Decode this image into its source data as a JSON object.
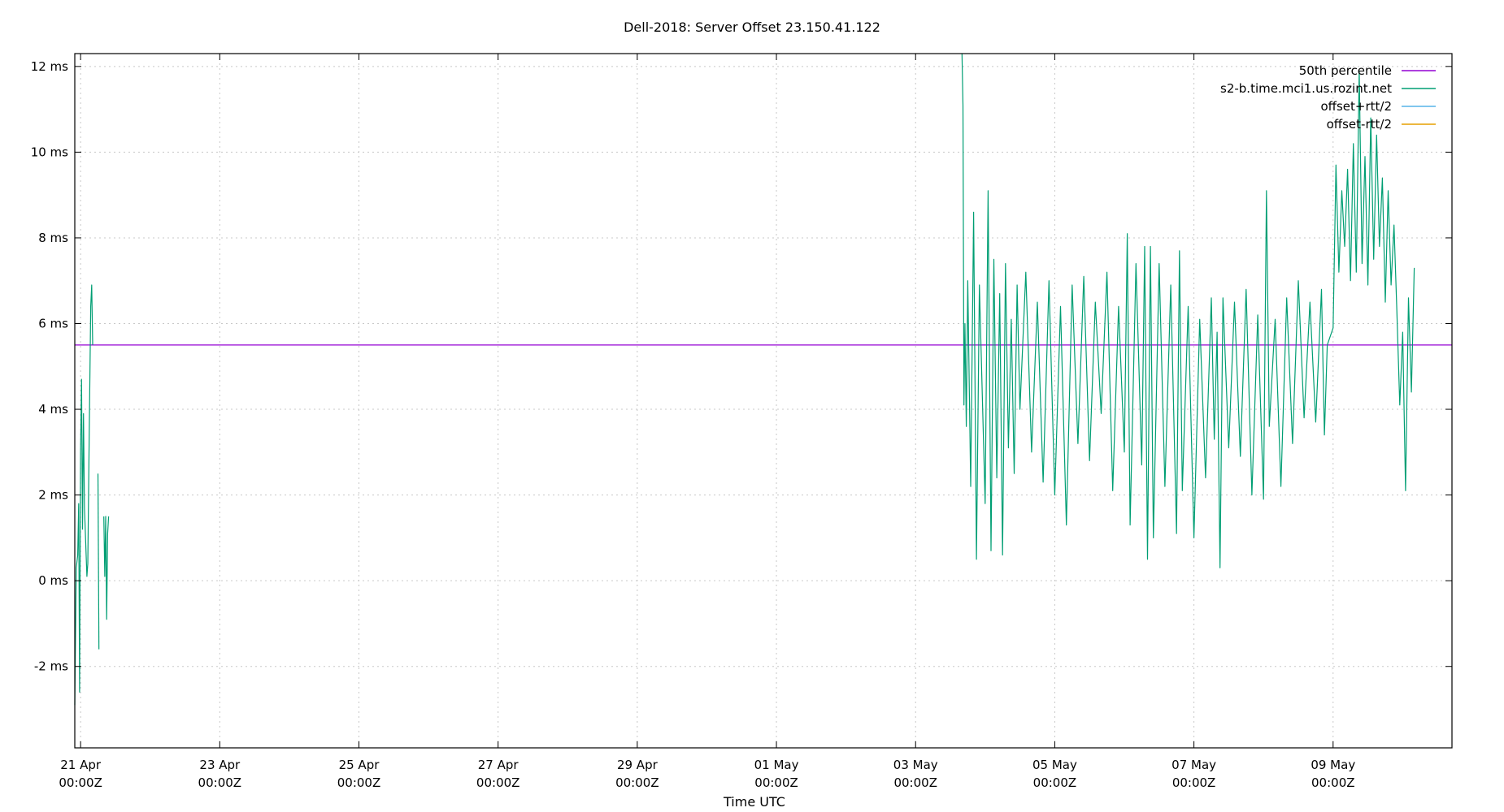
{
  "chart_data": {
    "type": "line",
    "title": "Dell-2018: Server Offset 23.150.41.122",
    "xlabel": "Time UTC",
    "ylabel": "",
    "y_unit": "ms",
    "ylim": [
      -3.9,
      12.3
    ],
    "xlim": [
      "2018-04-20T22:00Z",
      "2018-05-10T17:00Z"
    ],
    "grid": true,
    "legend_position": "top-right",
    "y_ticks": [
      {
        "value": -2,
        "label": "-2 ms"
      },
      {
        "value": 0,
        "label": "0 ms"
      },
      {
        "value": 2,
        "label": "2 ms"
      },
      {
        "value": 4,
        "label": "4 ms"
      },
      {
        "value": 6,
        "label": "6 ms"
      },
      {
        "value": 8,
        "label": "8 ms"
      },
      {
        "value": 10,
        "label": "10 ms"
      },
      {
        "value": 12,
        "label": "12 ms"
      }
    ],
    "x_ticks": [
      {
        "value": "2018-04-21T00:00Z",
        "label": "21 Apr",
        "label2": "00:00Z"
      },
      {
        "value": "2018-04-23T00:00Z",
        "label": "23 Apr",
        "label2": "00:00Z"
      },
      {
        "value": "2018-04-25T00:00Z",
        "label": "25 Apr",
        "label2": "00:00Z"
      },
      {
        "value": "2018-04-27T00:00Z",
        "label": "27 Apr",
        "label2": "00:00Z"
      },
      {
        "value": "2018-04-29T00:00Z",
        "label": "29 Apr",
        "label2": "00:00Z"
      },
      {
        "value": "2018-05-01T00:00Z",
        "label": "01 May",
        "label2": "00:00Z"
      },
      {
        "value": "2018-05-03T00:00Z",
        "label": "03 May",
        "label2": "00:00Z"
      },
      {
        "value": "2018-05-05T00:00Z",
        "label": "05 May",
        "label2": "00:00Z"
      },
      {
        "value": "2018-05-07T00:00Z",
        "label": "07 May",
        "label2": "00:00Z"
      },
      {
        "value": "2018-05-09T00:00Z",
        "label": "09 May",
        "label2": "00:00Z"
      }
    ],
    "series": [
      {
        "name": "50th percentile",
        "color": "#9400d3",
        "kind": "constant",
        "value": 5.5
      },
      {
        "name": "s2-b.time.mci1.us.rozint.net",
        "color": "#009e73",
        "kind": "line",
        "segments": [
          [
            [
              "2018-04-20T22:00Z",
              -2.9
            ],
            [
              "2018-04-20T22:30Z",
              0.3
            ],
            [
              "2018-04-20T23:00Z",
              0.6
            ],
            [
              "2018-04-20T23:20Z",
              1.8
            ],
            [
              "2018-04-20T23:40Z",
              -2.6
            ],
            [
              "2018-04-21T00:00Z",
              3.0
            ],
            [
              "2018-04-21T00:20Z",
              4.7
            ],
            [
              "2018-04-21T00:40Z",
              1.2
            ],
            [
              "2018-04-21T01:00Z",
              3.9
            ],
            [
              "2018-04-21T01:20Z",
              1.7
            ],
            [
              "2018-04-21T02:10Z",
              0.1
            ],
            [
              "2018-04-21T02:30Z",
              0.4
            ],
            [
              "2018-04-21T03:00Z",
              3.5
            ],
            [
              "2018-04-21T03:30Z",
              6.4
            ],
            [
              "2018-04-21T03:50Z",
              6.9
            ],
            [
              "2018-04-21T04:10Z",
              5.5
            ]
          ],
          [
            [
              "2018-04-21T06:00Z",
              2.5
            ],
            [
              "2018-04-21T06:20Z",
              -1.6
            ]
          ],
          [
            [
              "2018-04-21T08:00Z",
              1.5
            ],
            [
              "2018-04-21T08:20Z",
              0.1
            ],
            [
              "2018-04-21T08:40Z",
              1.5
            ],
            [
              "2018-04-21T09:00Z",
              -0.9
            ],
            [
              "2018-04-21T09:20Z",
              1.1
            ],
            [
              "2018-04-21T09:40Z",
              1.5
            ]
          ],
          [
            [
              "2018-05-03T16:00Z",
              13.0
            ],
            [
              "2018-05-03T16:20Z",
              11.1
            ],
            [
              "2018-05-03T16:40Z",
              4.1
            ],
            [
              "2018-05-03T17:00Z",
              6.0
            ],
            [
              "2018-05-03T17:30Z",
              3.6
            ],
            [
              "2018-05-03T18:00Z",
              7.0
            ],
            [
              "2018-05-03T19:00Z",
              2.2
            ],
            [
              "2018-05-03T20:00Z",
              8.6
            ],
            [
              "2018-05-03T21:00Z",
              0.5
            ],
            [
              "2018-05-03T22:00Z",
              6.9
            ],
            [
              "2018-05-04T00:00Z",
              1.8
            ],
            [
              "2018-05-04T01:00Z",
              9.1
            ],
            [
              "2018-05-04T02:00Z",
              0.7
            ],
            [
              "2018-05-04T03:00Z",
              7.5
            ],
            [
              "2018-05-04T04:00Z",
              2.4
            ],
            [
              "2018-05-04T05:00Z",
              6.7
            ],
            [
              "2018-05-04T06:00Z",
              0.6
            ],
            [
              "2018-05-04T07:00Z",
              7.4
            ],
            [
              "2018-05-04T08:00Z",
              3.1
            ],
            [
              "2018-05-04T09:00Z",
              6.1
            ],
            [
              "2018-05-04T10:00Z",
              2.5
            ],
            [
              "2018-05-04T11:00Z",
              6.9
            ],
            [
              "2018-05-04T12:00Z",
              4.0
            ],
            [
              "2018-05-04T14:00Z",
              7.2
            ],
            [
              "2018-05-04T16:00Z",
              3.0
            ],
            [
              "2018-05-04T18:00Z",
              6.5
            ],
            [
              "2018-05-04T20:00Z",
              2.3
            ],
            [
              "2018-05-04T22:00Z",
              7.0
            ],
            [
              "2018-05-05T00:00Z",
              2.0
            ],
            [
              "2018-05-05T02:00Z",
              6.4
            ],
            [
              "2018-05-05T04:00Z",
              1.3
            ],
            [
              "2018-05-05T06:00Z",
              6.9
            ],
            [
              "2018-05-05T08:00Z",
              3.2
            ],
            [
              "2018-05-05T10:00Z",
              7.1
            ],
            [
              "2018-05-05T12:00Z",
              2.8
            ],
            [
              "2018-05-05T14:00Z",
              6.5
            ],
            [
              "2018-05-05T16:00Z",
              3.9
            ],
            [
              "2018-05-05T18:00Z",
              7.2
            ],
            [
              "2018-05-05T20:00Z",
              2.1
            ],
            [
              "2018-05-05T22:00Z",
              6.4
            ],
            [
              "2018-05-06T00:00Z",
              3.0
            ],
            [
              "2018-05-06T01:00Z",
              8.1
            ],
            [
              "2018-05-06T02:00Z",
              1.3
            ],
            [
              "2018-05-06T04:00Z",
              7.4
            ],
            [
              "2018-05-06T06:00Z",
              2.7
            ],
            [
              "2018-05-06T07:00Z",
              7.8
            ],
            [
              "2018-05-06T08:00Z",
              0.5
            ],
            [
              "2018-05-06T09:00Z",
              7.8
            ],
            [
              "2018-05-06T10:00Z",
              1.0
            ],
            [
              "2018-05-06T12:00Z",
              7.4
            ],
            [
              "2018-05-06T14:00Z",
              2.2
            ],
            [
              "2018-05-06T16:00Z",
              6.9
            ],
            [
              "2018-05-06T18:00Z",
              1.1
            ],
            [
              "2018-05-06T19:00Z",
              7.7
            ],
            [
              "2018-05-06T20:00Z",
              2.1
            ],
            [
              "2018-05-06T22:00Z",
              6.4
            ],
            [
              "2018-05-07T00:00Z",
              1.0
            ],
            [
              "2018-05-07T02:00Z",
              6.1
            ],
            [
              "2018-05-07T04:00Z",
              2.4
            ],
            [
              "2018-05-07T06:00Z",
              6.6
            ],
            [
              "2018-05-07T07:00Z",
              3.3
            ],
            [
              "2018-05-07T08:00Z",
              5.8
            ],
            [
              "2018-05-07T09:00Z",
              0.3
            ],
            [
              "2018-05-07T10:00Z",
              6.6
            ],
            [
              "2018-05-07T12:00Z",
              3.1
            ],
            [
              "2018-05-07T14:00Z",
              6.5
            ],
            [
              "2018-05-07T16:00Z",
              2.9
            ],
            [
              "2018-05-07T18:00Z",
              6.8
            ],
            [
              "2018-05-07T20:00Z",
              2.0
            ],
            [
              "2018-05-07T22:00Z",
              6.2
            ],
            [
              "2018-05-08T00:00Z",
              1.9
            ],
            [
              "2018-05-08T01:00Z",
              9.1
            ],
            [
              "2018-05-08T02:00Z",
              3.6
            ],
            [
              "2018-05-08T04:00Z",
              6.1
            ],
            [
              "2018-05-08T06:00Z",
              2.2
            ],
            [
              "2018-05-08T08:00Z",
              6.6
            ],
            [
              "2018-05-08T10:00Z",
              3.2
            ],
            [
              "2018-05-08T12:00Z",
              7.0
            ],
            [
              "2018-05-08T14:00Z",
              3.8
            ],
            [
              "2018-05-08T16:00Z",
              6.5
            ],
            [
              "2018-05-08T18:00Z",
              3.7
            ],
            [
              "2018-05-08T20:00Z",
              6.8
            ],
            [
              "2018-05-08T21:00Z",
              3.4
            ],
            [
              "2018-05-08T22:00Z",
              5.5
            ],
            [
              "2018-05-09T00:00Z",
              5.9
            ],
            [
              "2018-05-09T01:00Z",
              9.7
            ],
            [
              "2018-05-09T02:00Z",
              7.2
            ],
            [
              "2018-05-09T03:00Z",
              9.1
            ],
            [
              "2018-05-09T04:00Z",
              7.8
            ],
            [
              "2018-05-09T05:00Z",
              9.6
            ],
            [
              "2018-05-09T06:00Z",
              7.0
            ],
            [
              "2018-05-09T07:00Z",
              10.2
            ],
            [
              "2018-05-09T08:00Z",
              7.2
            ],
            [
              "2018-05-09T09:00Z",
              11.9
            ],
            [
              "2018-05-09T10:00Z",
              7.4
            ],
            [
              "2018-05-09T11:00Z",
              9.9
            ],
            [
              "2018-05-09T12:00Z",
              6.9
            ],
            [
              "2018-05-09T13:00Z",
              10.8
            ],
            [
              "2018-05-09T14:00Z",
              7.5
            ],
            [
              "2018-05-09T15:00Z",
              10.4
            ],
            [
              "2018-05-09T16:00Z",
              7.8
            ],
            [
              "2018-05-09T17:00Z",
              9.4
            ],
            [
              "2018-05-09T18:00Z",
              6.5
            ],
            [
              "2018-05-09T19:00Z",
              9.1
            ],
            [
              "2018-05-09T20:00Z",
              6.9
            ],
            [
              "2018-05-09T21:00Z",
              8.3
            ],
            [
              "2018-05-09T22:00Z",
              6.3
            ],
            [
              "2018-05-09T23:00Z",
              4.1
            ],
            [
              "2018-05-10T00:00Z",
              5.8
            ],
            [
              "2018-05-10T01:00Z",
              2.1
            ],
            [
              "2018-05-10T02:00Z",
              6.6
            ],
            [
              "2018-05-10T03:00Z",
              4.4
            ],
            [
              "2018-05-10T04:00Z",
              7.3
            ]
          ]
        ]
      },
      {
        "name": "offset+rtt/2",
        "color": "#56b4e9",
        "kind": "legend-only"
      },
      {
        "name": "offset-rtt/2",
        "color": "#e69f00",
        "kind": "legend-only"
      }
    ]
  }
}
